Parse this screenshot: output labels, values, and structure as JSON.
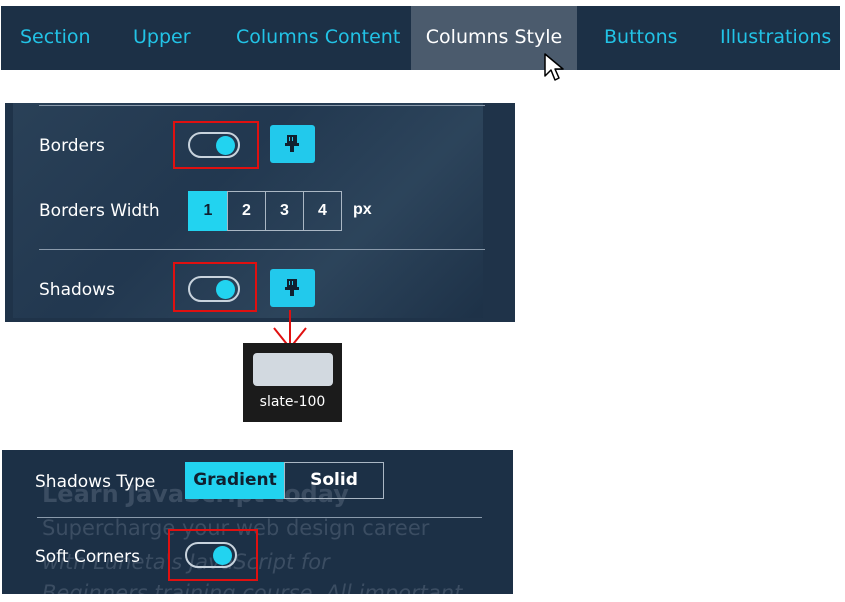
{
  "tabs": [
    {
      "label": "Section"
    },
    {
      "label": "Upper"
    },
    {
      "label": "Columns Content"
    },
    {
      "label": "Columns Style"
    },
    {
      "label": "Buttons"
    },
    {
      "label": "Illustrations"
    }
  ],
  "active_tab": "Columns Style",
  "panel_top": {
    "borders_label": "Borders",
    "borders_on": true,
    "borders_width_label": "Borders Width",
    "width_options": [
      "1",
      "2",
      "3",
      "4"
    ],
    "width_selected": "1",
    "width_unit": "px",
    "shadows_label": "Shadows",
    "shadows_on": true
  },
  "color_swatch": {
    "name": "slate-100",
    "color": "#d2d9e0"
  },
  "panel_bottom": {
    "shadows_type_label": "Shadows Type",
    "shadow_types": [
      "Gradient",
      "Solid"
    ],
    "shadow_type_selected": "Gradient",
    "soft_corners_label": "Soft Corners",
    "soft_corners_on": true,
    "background_text": {
      "heading": "Learn JavaScript today",
      "line1": "Supercharge your web design career",
      "line2": "with Luneta's JavaScript for",
      "line3": "Beginners training course. All important"
    }
  },
  "colors": {
    "accent": "#22d3f0",
    "panel": "#1c3046",
    "highlight": "#e01010"
  }
}
